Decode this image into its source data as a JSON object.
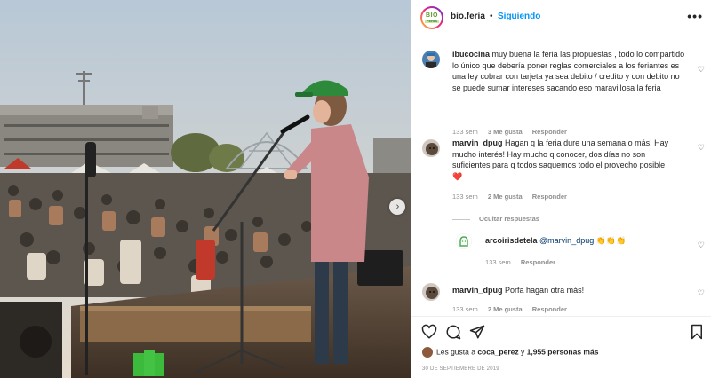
{
  "photo": {
    "alt_icon": "photo-concert"
  },
  "header": {
    "logo_top": "BIO",
    "logo_bottom": "FERIA",
    "username": "bio.feria",
    "separator": "•",
    "follow_label": "Siguiendo",
    "more_icon": "more-horizontal-icon",
    "more_label": "•••"
  },
  "comments": [
    {
      "username": "ibucocina",
      "text": "muy buena la feria las propuestas , todo lo compartido lo único que debería poner reglas comerciales a los feriantes es una ley cobrar con tarjeta ya sea debito / credito y con debito no se puede sumar intereses sacando eso maravillosa la feria",
      "time": "133 sem",
      "likes": "3 Me gusta",
      "reply": "Responder"
    },
    {
      "username": "marvin_dpug",
      "text": "Hagan q la feria dure una semana o más! Hay mucho interés! Hay mucho q conocer, dos días no son suficientes para q todos saquemos todo el provecho posible",
      "emoji": "❤️",
      "time": "133 sem",
      "likes": "2 Me gusta",
      "reply": "Responder"
    },
    {
      "username": "arcoirisdetela",
      "text": "@marvin_dpug 👏👏👏",
      "time": "133 sem",
      "reply": "Responder"
    },
    {
      "username": "marvin_dpug",
      "text": "Porfa hagan otra más!",
      "time": "133 sem",
      "likes": "2 Me gusta",
      "reply": "Responder"
    }
  ],
  "hide_replies_label": "Ocultar respuestas",
  "footer": {
    "likes_prefix": "Les gusta a",
    "likes_user": "coca_perez",
    "likes_join": "y",
    "likes_count": "1,955 personas más",
    "date": "30 DE SEPTIEMBRE DE 2019"
  },
  "colors": {
    "accent": "#0095f6",
    "muted": "#8e8e8e",
    "text": "#262626",
    "heart": "#ed4956"
  }
}
